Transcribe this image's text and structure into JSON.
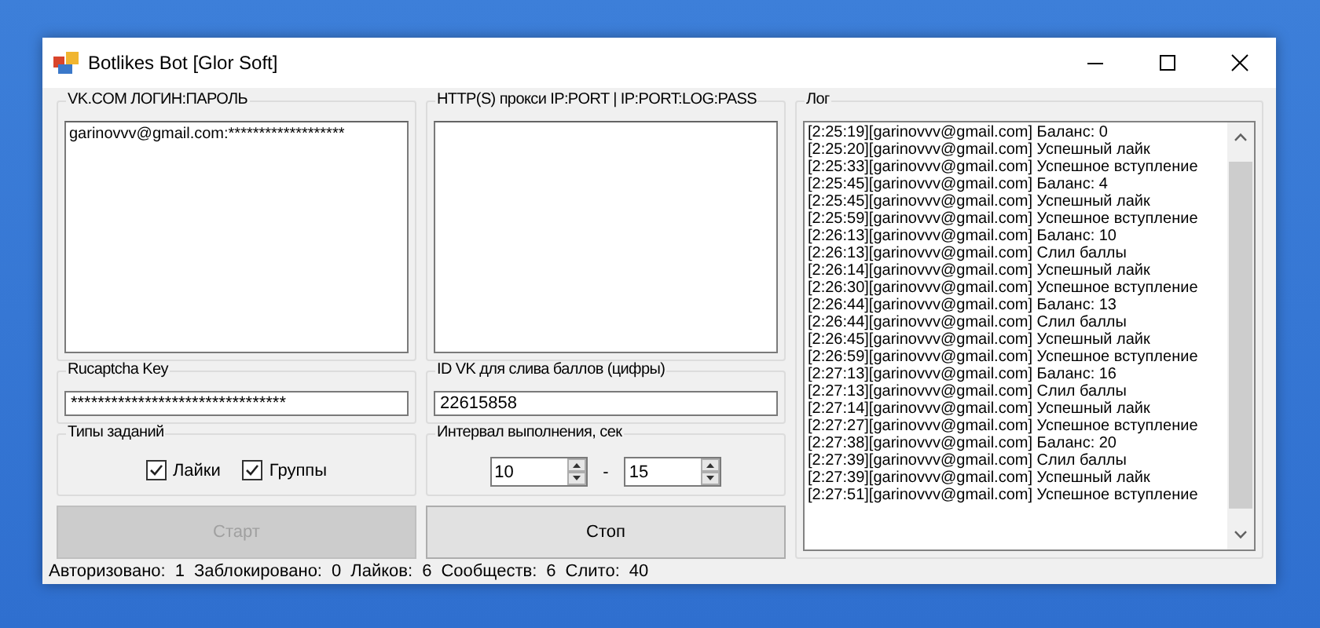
{
  "window": {
    "title": "Botlikes Bot [Glor Soft]"
  },
  "accounts": {
    "label": "VK.COM ЛОГИН:ПАРОЛЬ",
    "value": "garinovvv@gmail.com:*******************"
  },
  "proxies": {
    "label": "HTTP(S) прокси IP:PORT | IP:PORT:LOG:PASS"
  },
  "rucaptcha": {
    "label": "Rucaptcha Key",
    "value": "********************************"
  },
  "vk_id": {
    "label": "ID VK для слива баллов (цифры)",
    "value": "22615858"
  },
  "task_types": {
    "label": "Типы заданий",
    "items": [
      {
        "label": "Лайки",
        "checked": true
      },
      {
        "label": "Группы",
        "checked": true
      }
    ]
  },
  "interval": {
    "label": "Интервал выполнения, сек",
    "from": "10",
    "separator": "-",
    "to": "15"
  },
  "buttons": [
    {
      "label": "Старт",
      "disabled": true
    },
    {
      "label": "Стоп",
      "disabled": false
    }
  ],
  "log": {
    "label": "Лог",
    "lines": [
      "[2:25:19][garinovvv@gmail.com] Баланс: 0",
      "[2:25:20][garinovvv@gmail.com] Успешный лайк",
      "[2:25:33][garinovvv@gmail.com] Успешное вступление",
      "[2:25:45][garinovvv@gmail.com] Баланс: 4",
      "[2:25:45][garinovvv@gmail.com] Успешный лайк",
      "[2:25:59][garinovvv@gmail.com] Успешное вступление",
      "[2:26:13][garinovvv@gmail.com] Баланс: 10",
      "[2:26:13][garinovvv@gmail.com] Слил баллы",
      "[2:26:14][garinovvv@gmail.com] Успешный лайк",
      "[2:26:30][garinovvv@gmail.com] Успешное вступление",
      "[2:26:44][garinovvv@gmail.com] Баланс: 13",
      "[2:26:44][garinovvv@gmail.com] Слил баллы",
      "[2:26:45][garinovvv@gmail.com] Успешный лайк",
      "[2:26:59][garinovvv@gmail.com] Успешное вступление",
      "[2:27:13][garinovvv@gmail.com] Баланс: 16",
      "[2:27:13][garinovvv@gmail.com] Слил баллы",
      "[2:27:14][garinovvv@gmail.com] Успешный лайк",
      "[2:27:27][garinovvv@gmail.com] Успешное вступление",
      "[2:27:38][garinovvv@gmail.com] Баланс: 20",
      "[2:27:39][garinovvv@gmail.com] Слил баллы",
      "[2:27:39][garinovvv@gmail.com] Успешный лайк",
      "[2:27:51][garinovvv@gmail.com] Успешное вступление"
    ]
  },
  "status_bar": [
    {
      "label": "Авторизовано:",
      "value": "1"
    },
    {
      "label": "Заблокировано:",
      "value": "0"
    },
    {
      "label": "Лайков:",
      "value": "6"
    },
    {
      "label": "Сообществ:",
      "value": "6"
    },
    {
      "label": "Слито:",
      "value": "40"
    }
  ]
}
